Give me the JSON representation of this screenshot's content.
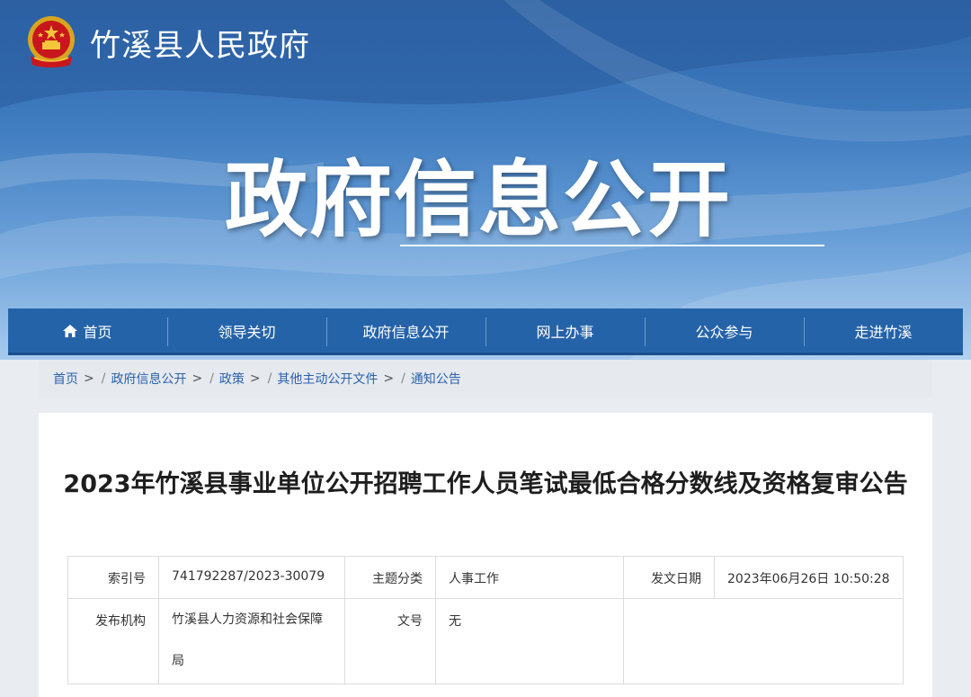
{
  "header": {
    "site_name": "竹溪县人民政府",
    "banner_title": "政府信息公开",
    "emblem_icon": "national-emblem-icon"
  },
  "nav": {
    "items": [
      {
        "label": "首页",
        "icon": "home-icon"
      },
      {
        "label": "领导关切"
      },
      {
        "label": "政府信息公开"
      },
      {
        "label": "网上办事"
      },
      {
        "label": "公众参与"
      },
      {
        "label": "走进竹溪"
      }
    ]
  },
  "breadcrumb": {
    "items": [
      "首页",
      "政府信息公开",
      "政策",
      "其他主动公开文件",
      "通知公告"
    ],
    "separator": ">"
  },
  "article": {
    "title": "2023年竹溪县事业单位公开招聘工作人员笔试最低合格分数线及资格复审公告",
    "meta": {
      "index_label": "索引号",
      "index_value": "741792287/2023-30079",
      "topic_label": "主题分类",
      "topic_value": "人事工作",
      "date_label": "发文日期",
      "date_value": "2023年06月26日 10:50:28",
      "publisher_label": "发布机构",
      "publisher_value": "竹溪县人力资源和社会保障局",
      "docno_label": "文号",
      "docno_value": "无"
    }
  },
  "colors": {
    "nav_bg": "#2563a9",
    "link": "#2a62ad",
    "banner_top": "#2f64a8"
  }
}
